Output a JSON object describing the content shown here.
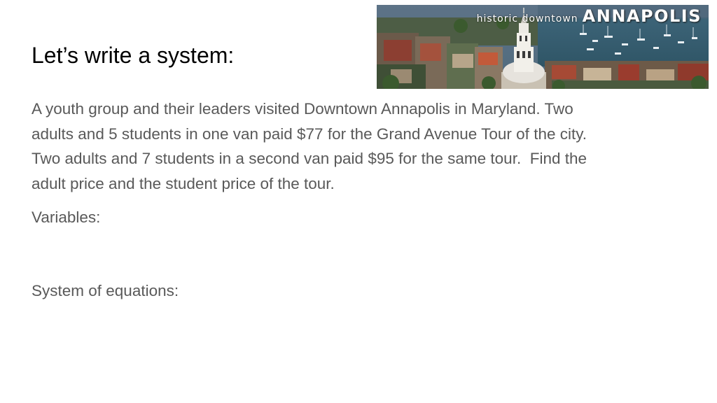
{
  "slide": {
    "title": "Let’s write a system:",
    "banner": {
      "small_text": "historic downtown",
      "big_text": "ANNAPOLIS"
    },
    "problem_lines": [
      "A youth group and their leaders visited Downtown Annapolis in Maryland. Two",
      "adults and 5 students in one van paid $77 for the Grand Avenue Tour of the city.",
      "Two adults and 7 students in a second van paid $95 for the same tour.  Find the",
      "adult price and the student price of the tour."
    ],
    "variables_label": "Variables:",
    "system_label": "System of equations:"
  }
}
